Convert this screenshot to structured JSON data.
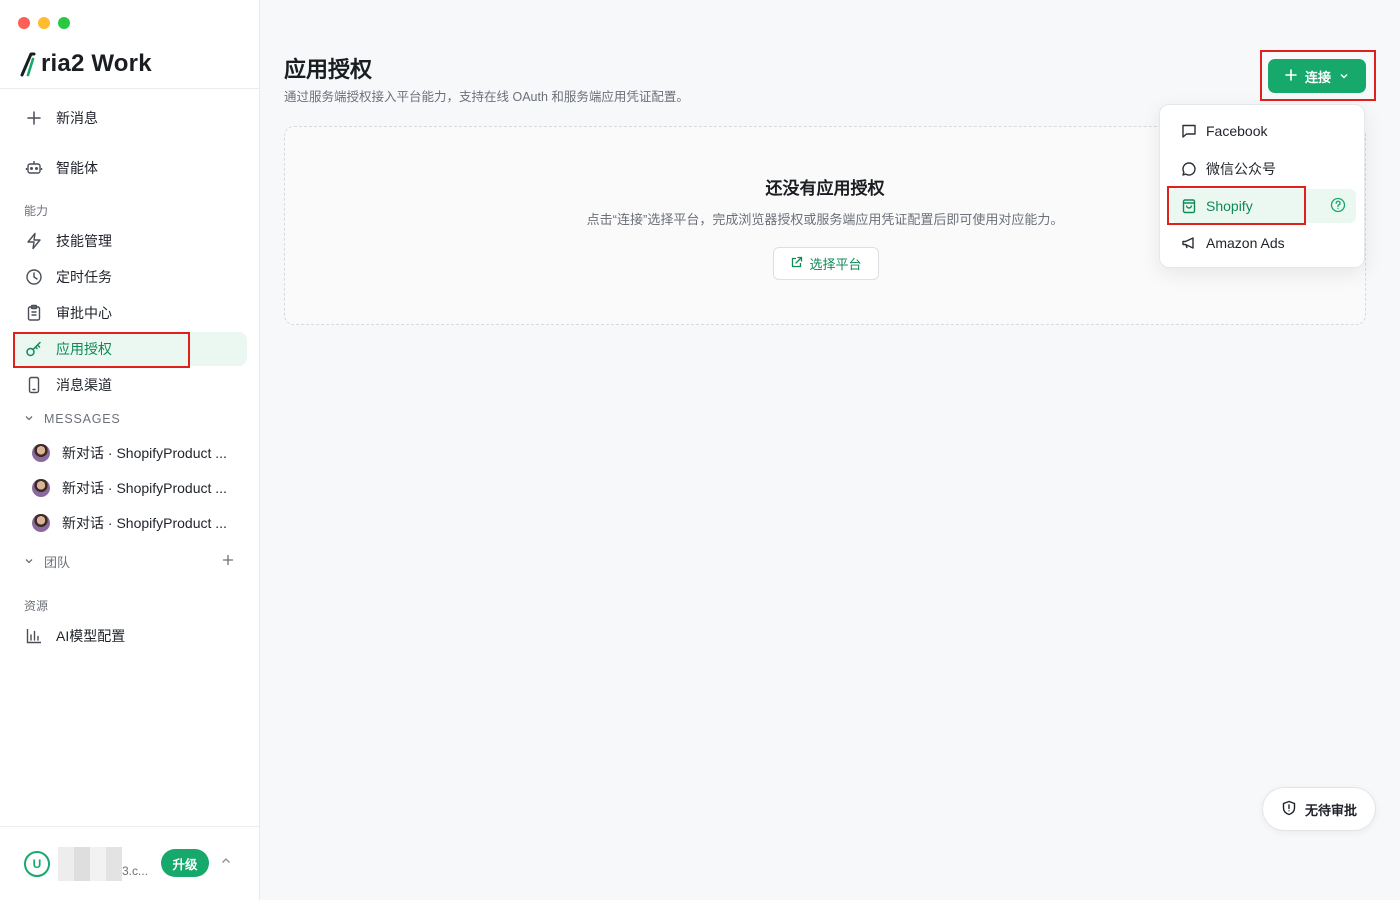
{
  "app": {
    "brand": "ria2 Work",
    "brand_mark": "A"
  },
  "sidebar": {
    "new_message": "新消息",
    "agents": "智能体",
    "section_capability": "能力",
    "items": [
      {
        "label": "技能管理",
        "icon": "lightning-icon"
      },
      {
        "label": "定时任务",
        "icon": "clock-icon"
      },
      {
        "label": "审批中心",
        "icon": "clipboard-icon"
      },
      {
        "label": "应用授权",
        "icon": "key-icon",
        "active": true
      },
      {
        "label": "消息渠道",
        "icon": "phone-icon"
      }
    ],
    "messages_header": "MESSAGES",
    "messages": [
      {
        "title": "新对话 · ShopifyProduct ..."
      },
      {
        "title": "新对话 · ShopifyProduct ..."
      },
      {
        "title": "新对话 · ShopifyProduct ..."
      }
    ],
    "team_header": "团队",
    "section_resources": "资源",
    "ai_model": "AI模型配置",
    "user": {
      "initial": "U",
      "email_suffix": "3.c...",
      "upgrade": "升级"
    }
  },
  "main": {
    "title": "应用授权",
    "subtitle": "通过服务端授权接入平台能力，支持在线 OAuth 和服务端应用凭证配置。",
    "connect_button": "连接",
    "empty": {
      "title": "还没有应用授权",
      "description": "点击“连接”选择平台，完成浏览器授权或服务端应用凭证配置后即可使用对应能力。",
      "choose_button": "选择平台"
    },
    "dropdown": [
      {
        "label": "Facebook",
        "icon": "message-square-icon"
      },
      {
        "label": "微信公众号",
        "icon": "message-circle-icon"
      },
      {
        "label": "Shopify",
        "icon": "shopping-bag-icon",
        "active": true
      },
      {
        "label": "Amazon Ads",
        "icon": "megaphone-icon"
      }
    ],
    "approval_pill": "无待审批"
  },
  "colors": {
    "accent": "#17a86b",
    "highlight": "#e0201b",
    "active_bg": "#ebf8f1"
  }
}
